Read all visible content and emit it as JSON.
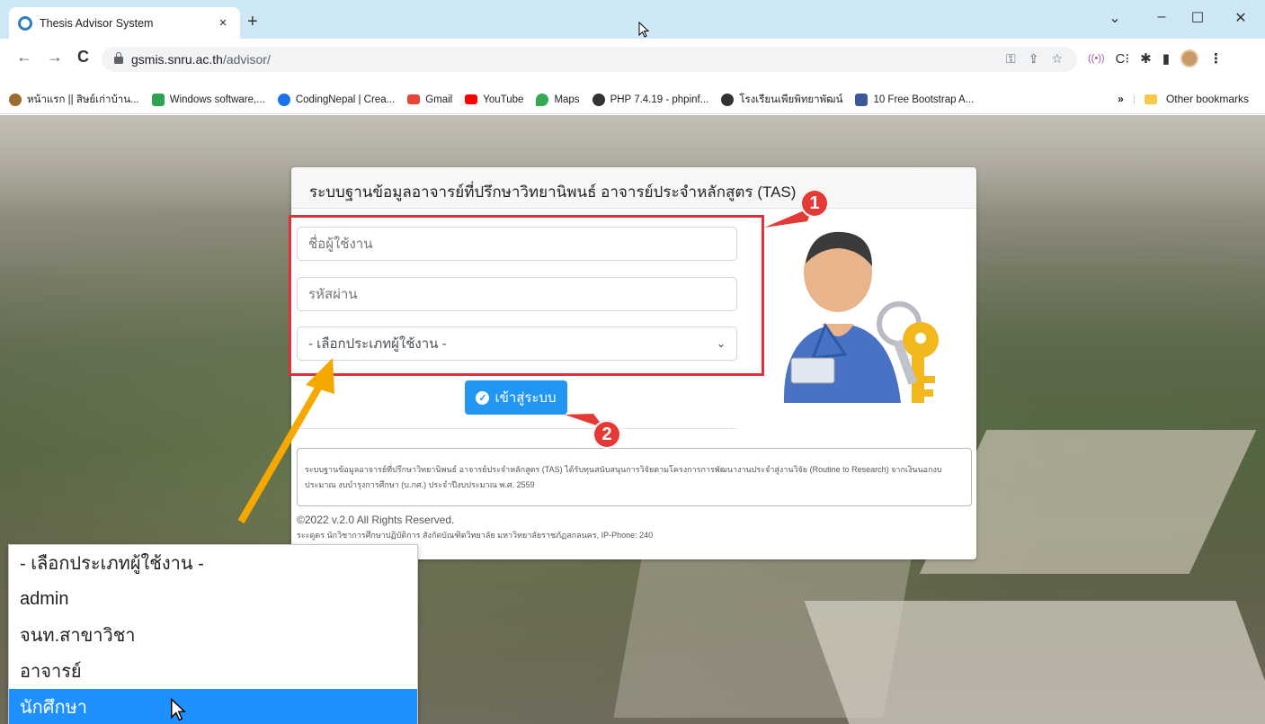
{
  "browser": {
    "tab": {
      "title": "Thesis Advisor System",
      "close": "×"
    },
    "new_tab": "+",
    "window_controls": {
      "minimize": "–",
      "maximize": "☐",
      "close": "✕",
      "tab_search": "⌄"
    },
    "nav": {
      "back": "←",
      "forward": "→",
      "reload": "C"
    },
    "url": {
      "host": "gsmis.snru.ac.th",
      "path": "/advisor/"
    },
    "bookmarks": [
      {
        "label": "หน้าแรก || สิษย์เก่าบ้าน...",
        "color": "#9c6b2e"
      },
      {
        "label": "Windows software,...",
        "color": "#2ea44f"
      },
      {
        "label": "CodingNepal | Crea...",
        "color": "#1a73e8"
      },
      {
        "label": "Gmail",
        "color": "#ea4335"
      },
      {
        "label": "YouTube",
        "color": "#ff0000"
      },
      {
        "label": "Maps",
        "color": "#34a853"
      },
      {
        "label": "PHP 7.4.19 - phpinf...",
        "color": "#333333"
      },
      {
        "label": "โรงเรียนเพียพิทยาพัฒน์",
        "color": "#333333"
      },
      {
        "label": "10 Free Bootstrap A...",
        "color": "#3b5998"
      }
    ],
    "bookmarks_more": "»",
    "other_bookmarks": "Other bookmarks"
  },
  "login": {
    "title": "ระบบฐานข้อมูลอาจารย์ที่ปรึกษาวิทยานิพนธ์ อาจารย์ประจำหลักสูตร (TAS)",
    "username_placeholder": "ชื่อผู้ใช้งาน",
    "password_placeholder": "รหัสผ่าน",
    "user_type_selected": "- เลือกประเภทผู้ใช้งาน -",
    "button_label": "เข้าสู่ระบบ",
    "info_text": "ระบบฐานข้อมูลอาจารย์ที่ปรึกษาวิทยานิพนธ์ อาจารย์ประจำหลักสูตร (TAS) ได้รับทุนสนับสนุนการวิจัยตามโครงการการพัฒนางานประจำสู่งานวิจัย (Routine to Research) จากเงินนอกงบประมาณ งบบำรุงการศึกษา (บ.กศ.) ประจำปีงบประมาณ พ.ศ. 2559",
    "copyright": "©2022 v.2.0 All Rights Reserved.",
    "contact": "ระะดูดร นักวิชาการศึกษาปฏิบัติการ สังกัดบัณฑิตวิทยาลัย มหาวิทยาลัยราชภัฏสกลนคร, IP-Phone: 240"
  },
  "annotations": {
    "badge1": "1",
    "badge2": "2"
  },
  "dropdown_options": [
    {
      "label": "- เลือกประเภทผู้ใช้งาน -",
      "highlighted": false
    },
    {
      "label": "admin",
      "highlighted": false
    },
    {
      "label": "จนท.สาขาวิชา",
      "highlighted": false
    },
    {
      "label": "อาจารย์",
      "highlighted": false
    },
    {
      "label": "นักศึกษา",
      "highlighted": true
    }
  ],
  "colors": {
    "accent": "#2196f3",
    "annotation_red": "#e53935",
    "arrow_yellow": "#f5a800",
    "highlight": "#1e90ff"
  }
}
